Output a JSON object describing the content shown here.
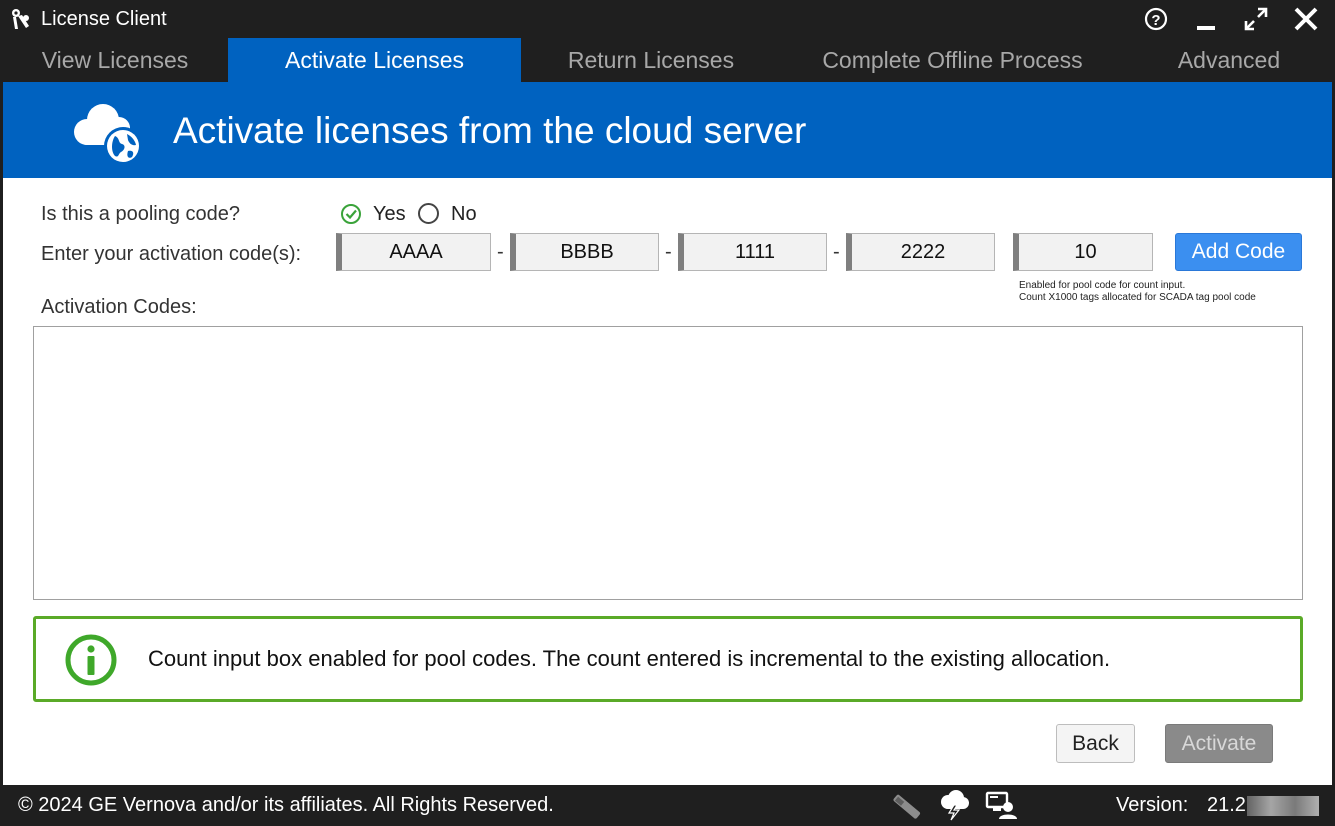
{
  "window": {
    "title": "License Client",
    "controls": {
      "help_icon": "help-circle-icon",
      "minimize_icon": "minimize-icon",
      "maximize_icon": "expand-icon",
      "close_icon": "close-icon"
    }
  },
  "tabs": [
    {
      "label": "View Licenses",
      "active": false
    },
    {
      "label": "Activate Licenses",
      "active": true
    },
    {
      "label": "Return Licenses",
      "active": false
    },
    {
      "label": "Complete Offline Process",
      "active": false
    },
    {
      "label": "Advanced",
      "active": false
    }
  ],
  "banner": {
    "title": "Activate licenses from the cloud server",
    "icon": "cloud-globe-icon"
  },
  "form": {
    "pooling_question": "Is this a pooling code?",
    "pooling_options": [
      {
        "label": "Yes",
        "checked": true
      },
      {
        "label": "No",
        "checked": false
      }
    ],
    "activation_label": "Enter your activation code(s):",
    "code_segments": [
      "AAAA",
      "BBBB",
      "1111",
      "2222"
    ],
    "separator": "-",
    "count_value": "10",
    "add_button": "Add Code",
    "hint_line1": "Enabled for pool code for count input.",
    "hint_line2": "Count X1000 tags allocated for SCADA tag pool code",
    "codes_label": "Activation Codes:"
  },
  "info": {
    "icon": "info-circle-icon",
    "message": "Count input box enabled for pool codes. The count entered is incremental to the existing allocation."
  },
  "actions": {
    "back": "Back",
    "activate": "Activate",
    "activate_enabled": false
  },
  "footer": {
    "copyright": "© 2024 GE Vernova and/or its affiliates.  All Rights Reserved.",
    "icons": [
      "usb-key-icon",
      "cloud-lightning-icon",
      "computer-user-icon"
    ],
    "version_label": "Version:",
    "version_value": "21.2"
  },
  "colors": {
    "accent": "#0062c0",
    "button_blue": "#3b8ff0",
    "info_border": "#5aaa28",
    "titlebar": "#1f1f1f"
  }
}
